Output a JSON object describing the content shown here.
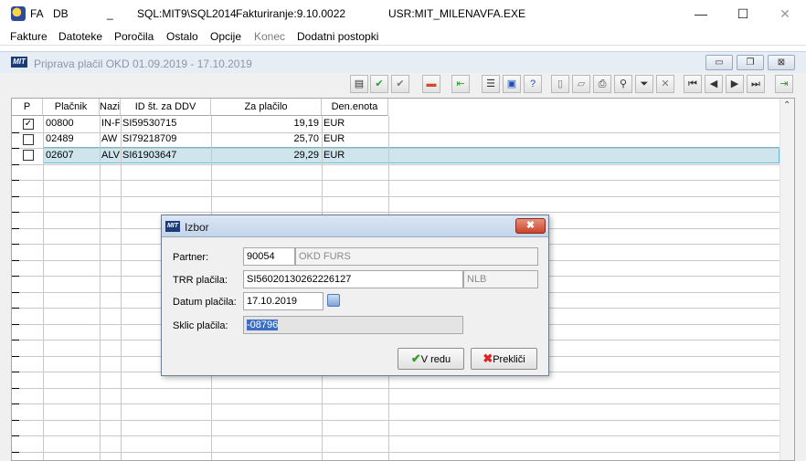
{
  "titlebar": {
    "fa": "FA",
    "db": "DB",
    "underscore": "_",
    "sql": "SQL:MIT9\\SQL2014",
    "version": "Fakturiranje:9.10.0022",
    "user": "USR:MIT_MILENA",
    "exe": "VFA.EXE",
    "min": "—",
    "max": "☐",
    "close": "✕"
  },
  "menu": [
    {
      "label": "Fakture"
    },
    {
      "label": "Datoteke"
    },
    {
      "label": "Poročila"
    },
    {
      "label": "Ostalo"
    },
    {
      "label": "Opcije"
    },
    {
      "label": "Konec"
    },
    {
      "label": "Dodatni postopki"
    }
  ],
  "child": {
    "logo": "MIT",
    "caption": "Priprava plačil OKD 01.09.2019 - 17.10.2019",
    "min": "▭",
    "restore": "❐",
    "close": "⊠"
  },
  "toolbar": [
    {
      "icon": "print-preview-icon",
      "glyph": "▤"
    },
    {
      "icon": "check-green-icon",
      "glyph": "✔"
    },
    {
      "icon": "check-gray-icon",
      "glyph": "✔"
    },
    {
      "icon": "card-icon",
      "glyph": "▬"
    },
    {
      "icon": "go-first-icon",
      "glyph": "⇤"
    },
    {
      "icon": "list-icon",
      "glyph": "☰"
    },
    {
      "icon": "monitor-icon",
      "glyph": "▣"
    },
    {
      "icon": "help-icon",
      "glyph": "?"
    },
    {
      "icon": "blank-page-icon",
      "glyph": "▯"
    },
    {
      "icon": "open-icon",
      "glyph": "▱"
    },
    {
      "icon": "printer-icon",
      "glyph": "⎙"
    },
    {
      "icon": "find-icon",
      "glyph": "⚲"
    },
    {
      "icon": "filter-icon",
      "glyph": "⏷"
    },
    {
      "icon": "cancel-filter-icon",
      "glyph": "✕"
    },
    {
      "icon": "first-record-icon",
      "glyph": "⏮"
    },
    {
      "icon": "prev-record-icon",
      "glyph": "◀"
    },
    {
      "icon": "next-record-icon",
      "glyph": "▶"
    },
    {
      "icon": "last-record-icon",
      "glyph": "⏭"
    },
    {
      "icon": "exit-icon",
      "glyph": "⇥"
    }
  ],
  "grid": {
    "headers": [
      "P",
      "Plačnik",
      "Nazi",
      "ID št. za DDV",
      "Za plačilo",
      "Den.enota"
    ],
    "rows": [
      {
        "checked": true,
        "check": "✓",
        "placnik": "00800",
        "naziv": "IN-F",
        "ddv": "SI59530715",
        "za_placilo": "19,19",
        "enota": "EUR"
      },
      {
        "checked": false,
        "check": "",
        "placnik": "02489",
        "naziv": "AW",
        "ddv": "SI79218709",
        "za_placilo": "25,70",
        "enota": "EUR"
      },
      {
        "checked": false,
        "check": "",
        "placnik": "02607",
        "naziv": "ALV",
        "ddv": "SI61903647",
        "za_placilo": "29,29",
        "enota": "EUR"
      }
    ]
  },
  "dialog": {
    "logo": "MIT",
    "title": "Izbor",
    "close": "✖",
    "partner_label": "Partner:",
    "partner_code": "90054",
    "partner_name": "OKD FURS",
    "trr_label": "TRR plačila:",
    "trr": "SI56020130262226127",
    "bank": "NLB",
    "datum_label": "Datum plačila:",
    "datum": "17.10.2019",
    "sklic_label": "Sklic plačila:",
    "sklic": "-08796",
    "ok_icon": "✔",
    "ok_label": "V redu",
    "cancel_icon": "✖",
    "cancel_label": "Prekliči"
  }
}
